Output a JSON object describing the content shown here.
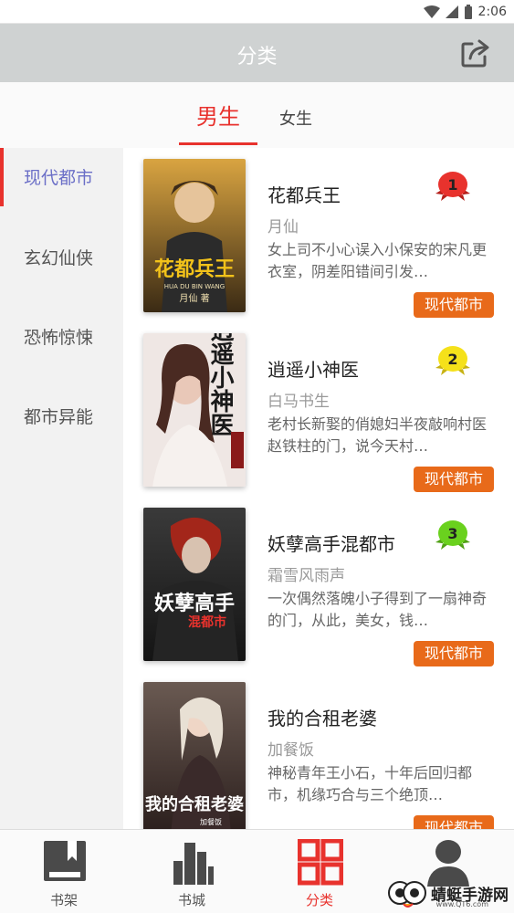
{
  "status_bar": {
    "time": "2:06"
  },
  "header": {
    "title": "分类"
  },
  "gender_tabs": {
    "male": "男生",
    "female": "女生"
  },
  "sidebar": {
    "items": [
      {
        "label": "现代都市",
        "active": true
      },
      {
        "label": "玄幻仙侠",
        "active": false
      },
      {
        "label": "恐怖惊悚",
        "active": false
      },
      {
        "label": "都市异能",
        "active": false
      }
    ]
  },
  "books": [
    {
      "rank": "1",
      "rank_color": "#e8322d",
      "title": "花都兵王",
      "author": "月仙",
      "desc": "女上司不小心误入小保安的宋凡更衣室，阴差阳错间引发…",
      "tag": "现代都市",
      "cover": {
        "title": "花都兵王",
        "subtitle": "HUA DU BIN WANG",
        "author": "月仙 著"
      }
    },
    {
      "rank": "2",
      "rank_color": "#f5e11a",
      "title": "逍遥小神医",
      "author": "白马书生",
      "desc": "老村长新娶的俏媳妇半夜敲响村医赵铁柱的门，说今天村…",
      "tag": "现代都市",
      "cover": {
        "title": "逍遥小神医"
      }
    },
    {
      "rank": "3",
      "rank_color": "#6ad11e",
      "title": "妖孽高手混都市",
      "author": "霜雪风雨声",
      "desc": "一次偶然落魄小子得到了一扇神奇的门，从此，美女，钱…",
      "tag": "现代都市",
      "cover": {
        "title": "妖孽高手",
        "subtitle": "混都市"
      }
    },
    {
      "rank": "",
      "rank_color": "",
      "title": "我的合租老婆",
      "author": "加餐饭",
      "desc": "神秘青年王小石，十年后回归都市，机缘巧合与三个绝顶…",
      "tag": "现代都市",
      "cover": {
        "title": "我的合租老婆",
        "author": "加餐饭"
      }
    }
  ],
  "bottom_nav": {
    "items": [
      {
        "label": "书架",
        "icon": "bookshelf-icon",
        "active": false
      },
      {
        "label": "书城",
        "icon": "bookstore-icon",
        "active": false
      },
      {
        "label": "分类",
        "icon": "category-icon",
        "active": true
      },
      {
        "label": "",
        "icon": "user-icon",
        "active": false
      }
    ]
  },
  "watermark": {
    "text": "蜻蜓手游网",
    "sub": "www.QT6.com"
  },
  "colors": {
    "accent": "#e8322d",
    "tag": "#e86a1a",
    "sidebar_active": "#6b6fc7",
    "header": "#cfd2d2"
  }
}
